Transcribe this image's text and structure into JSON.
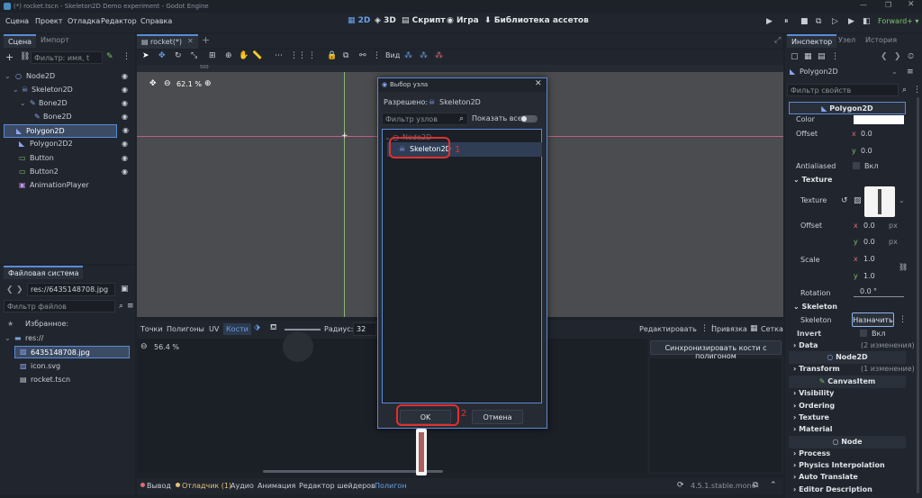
{
  "window": {
    "title": "(*) rocket.tscn - Skeleton2D Demo experiment - Godot Engine",
    "renderer": "Forward+"
  },
  "menu": [
    "Сцена",
    "Проект",
    "Отладка",
    "Редактор",
    "Справка"
  ],
  "workspaces": [
    "2D",
    "3D",
    "Скрипт",
    "Игра",
    "Библиотека ассетов"
  ],
  "scene_dock": {
    "tabs": [
      "Сцена",
      "Импорт"
    ],
    "filter_placeholder": "Фильтр: имя, t",
    "nodes": [
      {
        "name": "Node2D"
      },
      {
        "name": "Skeleton2D"
      },
      {
        "name": "Bone2D"
      },
      {
        "name": "Bone2D"
      },
      {
        "name": "Polygon2D"
      },
      {
        "name": "Polygon2D2"
      },
      {
        "name": "Button"
      },
      {
        "name": "Button2"
      },
      {
        "name": "AnimationPlayer"
      }
    ]
  },
  "filesystem": {
    "title": "Файловая система",
    "path": "res://6435148708.jpg",
    "filter_placeholder": "Фильтр файлов",
    "favorites": "Избранное:",
    "root": "res://",
    "files": [
      "6435148708.jpg",
      "icon.svg",
      "rocket.tscn"
    ]
  },
  "editor": {
    "tab": "rocket(*)",
    "view_menu": "Вид",
    "zoom": "62.1 %",
    "ruler_label": "500"
  },
  "polygon_panel": {
    "tabs": [
      "Точки",
      "Полигоны",
      "UV",
      "Кости"
    ],
    "radius_label": "Радиус:",
    "radius_value": "32",
    "zoom": "56.4 %",
    "edit": "Редактировать",
    "snap": "Привязка",
    "grid": "Сетка",
    "sync_button": "Синхронизировать кости с полигоном"
  },
  "dialog": {
    "title": "Выбор узла",
    "allowed_label": "Разрешено:",
    "allowed_value": "Skeleton2D",
    "filter_placeholder": "Фильтр узлов",
    "show_all": "Показать все",
    "tree": [
      {
        "name": "Node2D"
      },
      {
        "name": "Skeleton2D"
      }
    ],
    "ok": "OK",
    "cancel": "Отмена",
    "annot1": "1",
    "annot2": "2"
  },
  "bottom_bar": {
    "tabs": [
      "Вывод",
      "Отладчик (1)",
      "Аудио",
      "Анимация",
      "Редактор шейдеров",
      "Полигон"
    ],
    "version": "4.5.1.stable.mono"
  },
  "inspector": {
    "tabs": [
      "Инспектор",
      "Узел",
      "История"
    ],
    "node_type": "Polygon2D",
    "filter_placeholder": "Фильтр свойств",
    "header": "Polygon2D",
    "color_label": "Color",
    "offset_label": "Offset",
    "offset_x": "0.0",
    "offset_y": "0.0",
    "antialiased_label": "Antialiased",
    "antialiased_value": "Вкл",
    "texture_section": "Texture",
    "texture_label": "Texture",
    "tex_offset_label": "Offset",
    "tex_offset_x": "0.0",
    "tex_offset_y": "0.0",
    "px": "px",
    "scale_label": "Scale",
    "scale_x": "1.0",
    "scale_y": "1.0",
    "rotation_label": "Rotation",
    "rotation_value": "0.0",
    "rotation_unit": "°",
    "skeleton_section": "Skeleton",
    "skeleton_label": "Skeleton",
    "skeleton_button": "Назначить",
    "invert_label": "Invert",
    "invert_value": "Вкл",
    "data_label": "Data",
    "data_changes": "(2 изменения)",
    "node2d_header": "Node2D",
    "transform_label": "Transform",
    "transform_changes": "(1 изменение)",
    "canvasitem_header": "CanvasItem",
    "ci_sections": [
      "Visibility",
      "Ordering",
      "Texture",
      "Material"
    ],
    "node_header": "Node",
    "node_sections": [
      "Process",
      "Physics Interpolation",
      "Auto Translate",
      "Editor Description"
    ],
    "x": "x",
    "y": "y"
  },
  "colors": {
    "accent": "#5a8bd6",
    "annotation": "#e03030",
    "bg": "#1d2229"
  }
}
